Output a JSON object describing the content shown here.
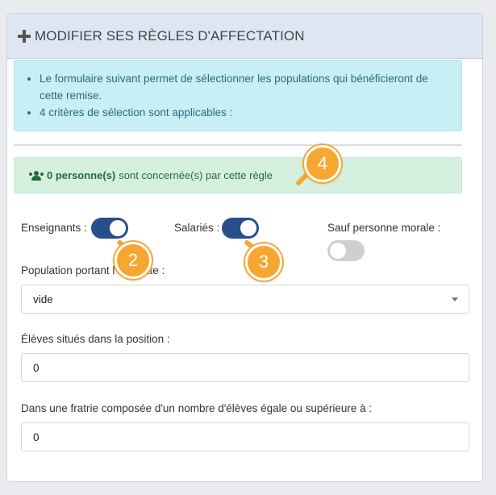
{
  "header": {
    "title": "MODIFIER SES RÈGLES D'AFFECTATION"
  },
  "info": {
    "items": [
      "Le formulaire suivant permet de sélectionner les populations qui bénéficieront de cette remise.",
      "4 critères de sélection sont applicables :"
    ]
  },
  "summary": {
    "count": "0 personne(s)",
    "text": "sont concernée(s) par cette règle"
  },
  "toggles": [
    {
      "label": "Enseignants :",
      "state": "on"
    },
    {
      "label": "Salariés :",
      "state": "on"
    },
    {
      "label": "Sauf personne morale :",
      "state": "off"
    }
  ],
  "population": {
    "label": "Population portant l'étiquette :",
    "value": "vide"
  },
  "position": {
    "label": "Élèves situés dans la position :",
    "value": "0"
  },
  "fratrie": {
    "label": "Dans une fratrie composée d'un nombre d'élèves égale ou supérieure à :",
    "value": "0"
  },
  "callouts": [
    "2",
    "3",
    "4"
  ],
  "colors": {
    "accent": "#264f8c",
    "callout": "#f6a731",
    "info_bg": "#c8eef6",
    "success_bg": "#d6f0df"
  }
}
